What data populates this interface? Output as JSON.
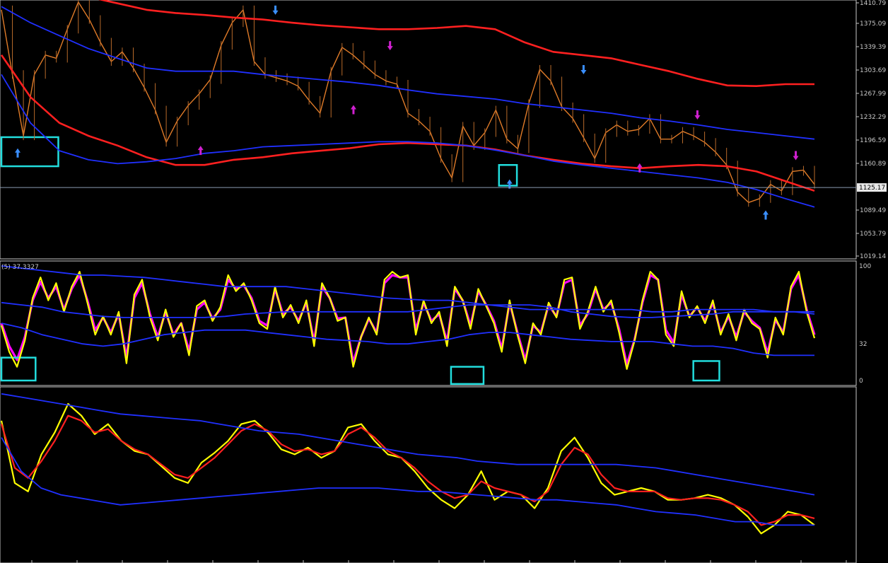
{
  "chart_data": [
    {
      "type": "line",
      "panel": "price",
      "y_ticks": [
        "1410.79",
        "1375.09",
        "1339.39",
        "1303.69",
        "1267.99",
        "1232.29",
        "1196.59",
        "1160.89",
        "1089.49",
        "1053.79",
        "1019.14"
      ],
      "current_price": "1125.17",
      "ylim": [
        1019.14,
        1410.79
      ],
      "series": [
        {
          "role": "price",
          "color": "#e07b28",
          "values": [
            1400,
            1300,
            1205,
            1300,
            1330,
            1325,
            1370,
            1412,
            1385,
            1350,
            1320,
            1335,
            1310,
            1280,
            1245,
            1195,
            1228,
            1252,
            1270,
            1292,
            1345,
            1380,
            1400,
            1320,
            1300,
            1295,
            1290,
            1282,
            1260,
            1240,
            1305,
            1342,
            1330,
            1315,
            1300,
            1290,
            1285,
            1240,
            1228,
            1212,
            1170,
            1140,
            1220,
            1190,
            1210,
            1245,
            1200,
            1185,
            1255,
            1308,
            1290,
            1250,
            1232,
            1202,
            1170,
            1210,
            1222,
            1212,
            1215,
            1232,
            1200,
            1200,
            1212,
            1205,
            1195,
            1180,
            1160,
            1118,
            1102,
            1108,
            1130,
            1120,
            1150,
            1152,
            1130
          ]
        },
        {
          "role": "ma-red-upper",
          "color": "#ff2020",
          "values": [
            1430,
            1428,
            1425,
            1420,
            1410,
            1400,
            1395,
            1392,
            1388,
            1385,
            1380,
            1376,
            1373,
            1370,
            1370,
            1372,
            1375,
            1370,
            1350,
            1335,
            1330,
            1325,
            1315,
            1305,
            1293,
            1283,
            1282,
            1285,
            1285
          ]
        },
        {
          "role": "ma-red-lower",
          "color": "#ff2020",
          "values": [
            1330,
            1265,
            1225,
            1205,
            1190,
            1172,
            1160,
            1160,
            1168,
            1172,
            1178,
            1182,
            1186,
            1192,
            1194,
            1192,
            1190,
            1184,
            1175,
            1168,
            1162,
            1158,
            1155,
            1158,
            1160,
            1158,
            1150,
            1135,
            1120
          ]
        },
        {
          "role": "band-blue-upper",
          "color": "#2030ff",
          "values": [
            1405,
            1380,
            1360,
            1340,
            1325,
            1310,
            1305,
            1305,
            1305,
            1300,
            1296,
            1292,
            1288,
            1283,
            1276,
            1270,
            1266,
            1262,
            1255,
            1250,
            1245,
            1240,
            1233,
            1228,
            1222,
            1215,
            1210,
            1205,
            1200
          ]
        },
        {
          "role": "band-blue-lower",
          "color": "#2030ff",
          "values": [
            1300,
            1225,
            1182,
            1168,
            1162,
            1165,
            1170,
            1178,
            1182,
            1188,
            1190,
            1192,
            1194,
            1196,
            1196,
            1194,
            1190,
            1183,
            1175,
            1166,
            1160,
            1155,
            1150,
            1145,
            1140,
            1133,
            1122,
            1108,
            1095
          ]
        }
      ],
      "markers": [
        {
          "kind": "up-arrow",
          "color": "#3a8fff",
          "x": 0.02,
          "y": 1178
        },
        {
          "kind": "down-arrow",
          "color": "#3a8fff",
          "x": 0.337,
          "y": 1400
        },
        {
          "kind": "down-arrow",
          "color": "#d020d0",
          "x": 0.478,
          "y": 1345
        },
        {
          "kind": "up-arrow",
          "color": "#d020d0",
          "x": 0.433,
          "y": 1245
        },
        {
          "kind": "up-arrow",
          "color": "#d020d0",
          "x": 0.245,
          "y": 1182
        },
        {
          "kind": "up-arrow",
          "color": "#3a8fff",
          "x": 0.625,
          "y": 1130
        },
        {
          "kind": "down-arrow",
          "color": "#3a8fff",
          "x": 0.716,
          "y": 1308
        },
        {
          "kind": "down-arrow",
          "color": "#d020d0",
          "x": 0.856,
          "y": 1238
        },
        {
          "kind": "up-arrow",
          "color": "#d020d0",
          "x": 0.785,
          "y": 1155
        },
        {
          "kind": "up-arrow",
          "color": "#3a8fff",
          "x": 0.94,
          "y": 1082
        },
        {
          "kind": "down-arrow",
          "color": "#d020d0",
          "x": 0.977,
          "y": 1175
        }
      ],
      "highlight_boxes": [
        {
          "color": "#22dddd",
          "x0": 0.0,
          "x1": 0.07,
          "y0": 1203,
          "y1": 1158
        },
        {
          "color": "#22dddd",
          "x0": 0.612,
          "x1": 0.634,
          "y0": 1160,
          "y1": 1128
        }
      ]
    },
    {
      "type": "line",
      "panel": "oscillator",
      "title": "(5) 37.3327",
      "y_ticks": [
        "100",
        "32",
        "0"
      ],
      "ylim": [
        0,
        100
      ],
      "series": [
        {
          "role": "oscillator-main",
          "color": "#ffff00",
          "values": [
            48,
            25,
            12,
            35,
            72,
            90,
            70,
            85,
            60,
            82,
            95,
            68,
            40,
            56,
            40,
            60,
            15,
            75,
            88,
            55,
            35,
            62,
            38,
            50,
            22,
            65,
            70,
            52,
            64,
            92,
            78,
            85,
            70,
            50,
            45,
            82,
            55,
            66,
            50,
            70,
            30,
            85,
            72,
            52,
            55,
            12,
            38,
            55,
            40,
            88,
            95,
            90,
            92,
            40,
            70,
            50,
            60,
            30,
            82,
            70,
            45,
            80,
            65,
            50,
            25,
            70,
            40,
            15,
            50,
            40,
            68,
            55,
            88,
            90,
            45,
            60,
            82,
            60,
            70,
            42,
            10,
            35,
            70,
            95,
            88,
            40,
            30,
            78,
            55,
            65,
            50,
            70,
            40,
            58,
            35,
            62,
            50,
            45,
            20,
            55,
            40,
            82,
            95,
            60,
            37
          ]
        },
        {
          "role": "oscillator-signal",
          "color": "#ff00ff",
          "values": [
            50,
            30,
            18,
            38,
            70,
            86,
            72,
            82,
            62,
            80,
            92,
            70,
            44,
            55,
            42,
            58,
            20,
            72,
            85,
            58,
            38,
            60,
            40,
            50,
            26,
            62,
            68,
            54,
            62,
            88,
            80,
            83,
            72,
            52,
            48,
            80,
            58,
            64,
            52,
            68,
            34,
            82,
            72,
            54,
            55,
            16,
            38,
            54,
            42,
            85,
            92,
            90,
            90,
            44,
            68,
            52,
            58,
            34,
            80,
            70,
            48,
            78,
            66,
            52,
            28,
            68,
            42,
            18,
            48,
            42,
            66,
            56,
            85,
            88,
            48,
            58,
            80,
            62,
            68,
            45,
            14,
            36,
            68,
            92,
            88,
            44,
            33,
            75,
            56,
            64,
            52,
            68,
            42,
            56,
            38,
            60,
            52,
            46,
            24,
            53,
            42,
            80,
            92,
            62,
            40
          ]
        },
        {
          "role": "band-blue-upper",
          "color": "#2030ff",
          "values": [
            100,
            98,
            96,
            94,
            92,
            92,
            91,
            90,
            88,
            86,
            84,
            82,
            82,
            82,
            82,
            80,
            78,
            76,
            74,
            72,
            71,
            70,
            70,
            68,
            66,
            64,
            62,
            62,
            62,
            62,
            62,
            62,
            60,
            60,
            62,
            62,
            62,
            62,
            60,
            60,
            58
          ]
        },
        {
          "role": "band-blue-mid",
          "color": "#2030ff",
          "values": [
            68,
            66,
            64,
            60,
            58,
            56,
            55,
            55,
            55,
            55,
            55,
            56,
            58,
            59,
            60,
            60,
            60,
            60,
            60,
            60,
            60,
            62,
            64,
            66,
            66,
            66,
            66,
            64,
            60,
            58,
            56,
            55,
            55,
            56,
            57,
            58,
            60,
            60,
            60,
            60,
            60
          ]
        },
        {
          "role": "band-blue-lower",
          "color": "#2030ff",
          "values": [
            50,
            46,
            40,
            36,
            32,
            30,
            32,
            36,
            40,
            42,
            44,
            44,
            44,
            42,
            40,
            38,
            36,
            35,
            34,
            32,
            32,
            34,
            36,
            40,
            42,
            42,
            40,
            38,
            36,
            35,
            34,
            34,
            34,
            32,
            30,
            30,
            28,
            24,
            22,
            22,
            22
          ]
        }
      ],
      "highlight_boxes": [
        {
          "color": "#22dddd",
          "x0": 0.0,
          "x1": 0.042,
          "y0": 20,
          "y1": 0
        },
        {
          "color": "#22dddd",
          "x0": 0.553,
          "x1": 0.593,
          "y0": 12,
          "y1": -3
        },
        {
          "color": "#22dddd",
          "x0": 0.851,
          "x1": 0.883,
          "y0": 17,
          "y1": 0
        }
      ]
    },
    {
      "type": "line",
      "panel": "ma-ribbon",
      "y_ticks": [],
      "ylim": [
        0,
        100
      ],
      "series": [
        {
          "role": "price-ma-fast",
          "color": "#ffff00",
          "values": [
            82,
            45,
            40,
            62,
            75,
            92,
            85,
            74,
            80,
            70,
            64,
            62,
            55,
            48,
            45,
            57,
            63,
            70,
            80,
            82,
            75,
            65,
            62,
            66,
            60,
            64,
            78,
            80,
            70,
            62,
            60,
            52,
            42,
            35,
            30,
            38,
            52,
            35,
            40,
            38,
            30,
            42,
            64,
            72,
            60,
            45,
            38,
            40,
            42,
            40,
            35,
            35,
            36,
            38,
            36,
            32,
            25,
            15,
            20,
            28,
            26,
            20
          ]
        },
        {
          "role": "price-ma-slow",
          "color": "#ff2020",
          "values": [
            80,
            54,
            48,
            58,
            70,
            85,
            82,
            75,
            77,
            70,
            65,
            62,
            56,
            50,
            48,
            54,
            60,
            68,
            76,
            80,
            76,
            68,
            64,
            65,
            62,
            64,
            74,
            78,
            72,
            64,
            60,
            54,
            46,
            40,
            36,
            38,
            46,
            42,
            40,
            38,
            34,
            40,
            56,
            66,
            62,
            50,
            42,
            40,
            40,
            40,
            36,
            35,
            36,
            36,
            35,
            32,
            28,
            20,
            22,
            26,
            26,
            24
          ]
        },
        {
          "role": "band-blue-upper",
          "color": "#2030ff",
          "values": [
            98,
            96,
            94,
            92,
            90,
            88,
            86,
            85,
            84,
            83,
            82,
            80,
            78,
            76,
            75,
            74,
            72,
            70,
            68,
            66,
            64,
            62,
            61,
            60,
            58,
            57,
            56,
            56,
            56,
            56,
            56,
            56,
            55,
            54,
            52,
            50,
            48,
            46,
            44,
            42,
            40,
            38
          ]
        },
        {
          "role": "band-blue-lower",
          "color": "#2030ff",
          "values": [
            72,
            52,
            42,
            38,
            36,
            34,
            32,
            33,
            34,
            35,
            36,
            37,
            38,
            39,
            40,
            41,
            42,
            42,
            42,
            42,
            41,
            40,
            40,
            39,
            38,
            37,
            36,
            35,
            35,
            34,
            33,
            32,
            30,
            28,
            27,
            26,
            24,
            22,
            22,
            20,
            20,
            20
          ]
        }
      ]
    }
  ]
}
